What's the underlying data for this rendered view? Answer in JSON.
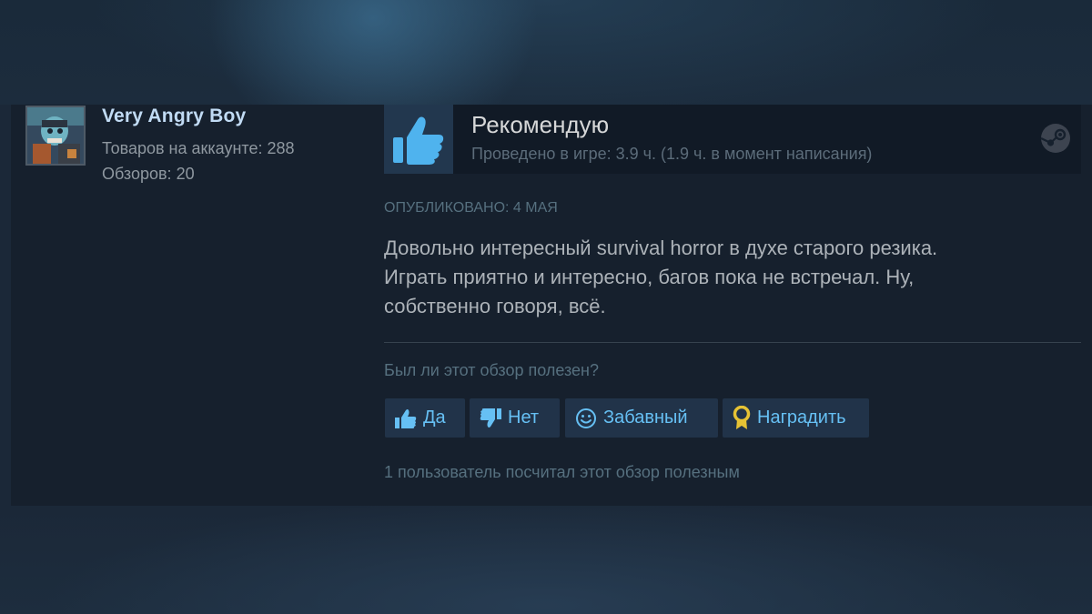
{
  "author": {
    "name": "Very Angry Boy",
    "products_label": "Товаров на аккаунте: 288",
    "reviews_label": "Обзоров: 20"
  },
  "review": {
    "verdict": "Рекомендую",
    "verdict_icon": "thumbs-up-icon",
    "hours": "Проведено в игре: 3.9 ч. (1.9 ч. в момент написания)",
    "posted": "Опубликовано: 4 мая",
    "text_lines": [
      "Довольно интересный survival horror в духе старого резика.",
      "Играть приятно и интересно, багов пока не встречал. Ну,",
      "собственно говоря, всё."
    ]
  },
  "feedback": {
    "question": "Был ли этот обзор полезен?",
    "buttons": {
      "yes": "Да",
      "no": "Нет",
      "funny": "Забавный",
      "award": "Наградить"
    },
    "helpful_count": "1 пользователь посчитал этот обзор полезным"
  },
  "colors": {
    "accent": "#66c0f4",
    "username": "#c1dbf4",
    "award_gold": "#e6c234"
  }
}
